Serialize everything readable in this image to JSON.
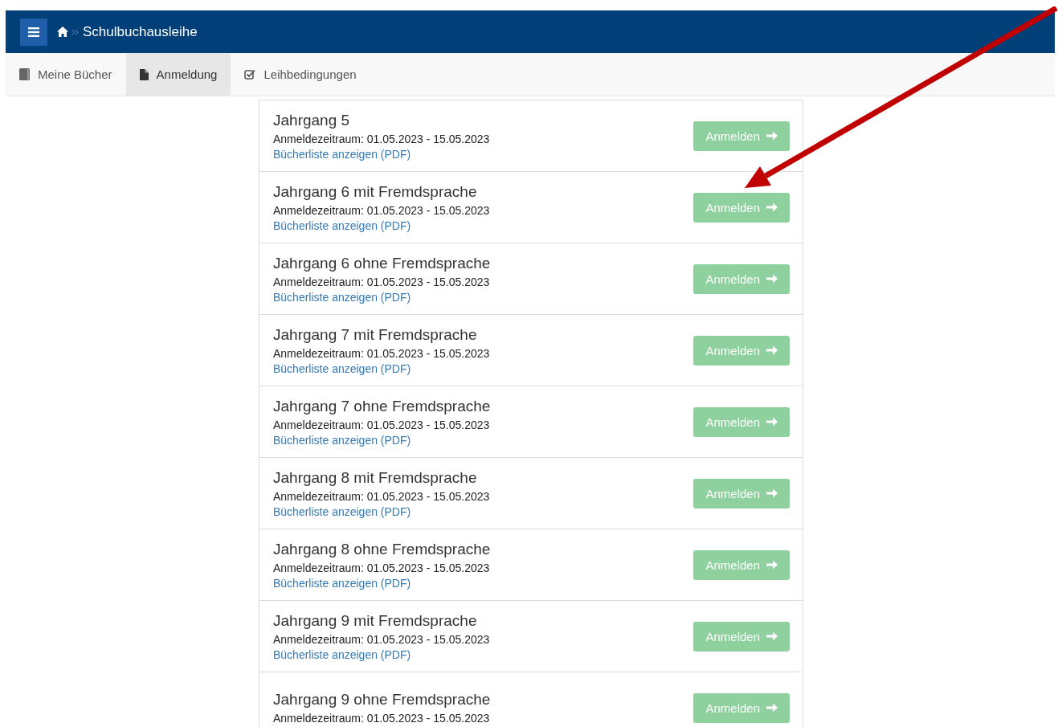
{
  "header": {
    "title": "Schulbuchausleihe"
  },
  "tabs": [
    {
      "label": "Meine Bücher",
      "selected": false
    },
    {
      "label": "Anmeldung",
      "selected": true
    },
    {
      "label": "Leihbedingungen",
      "selected": false
    }
  ],
  "registrations": [
    {
      "title": "Jahrgang 5",
      "period": "Anmeldezeitraum: 01.05.2023 - 15.05.2023",
      "link": "Bücherliste anzeigen (PDF)",
      "button": "Anmelden"
    },
    {
      "title": "Jahrgang 6 mit Fremdsprache",
      "period": "Anmeldezeitraum: 01.05.2023 - 15.05.2023",
      "link": "Bücherliste anzeigen (PDF)",
      "button": "Anmelden"
    },
    {
      "title": "Jahrgang 6 ohne Fremdsprache",
      "period": "Anmeldezeitraum: 01.05.2023 - 15.05.2023",
      "link": "Bücherliste anzeigen (PDF)",
      "button": "Anmelden"
    },
    {
      "title": "Jahrgang 7 mit Fremdsprache",
      "period": "Anmeldezeitraum: 01.05.2023 - 15.05.2023",
      "link": "Bücherliste anzeigen (PDF)",
      "button": "Anmelden"
    },
    {
      "title": "Jahrgang 7 ohne Fremdsprache",
      "period": "Anmeldezeitraum: 01.05.2023 - 15.05.2023",
      "link": "Bücherliste anzeigen (PDF)",
      "button": "Anmelden"
    },
    {
      "title": "Jahrgang 8 mit Fremdsprache",
      "period": "Anmeldezeitraum: 01.05.2023 - 15.05.2023",
      "link": "Bücherliste anzeigen (PDF)",
      "button": "Anmelden"
    },
    {
      "title": "Jahrgang 8 ohne Fremdsprache",
      "period": "Anmeldezeitraum: 01.05.2023 - 15.05.2023",
      "link": "Bücherliste anzeigen (PDF)",
      "button": "Anmelden"
    },
    {
      "title": "Jahrgang 9 mit Fremdsprache",
      "period": "Anmeldezeitraum: 01.05.2023 - 15.05.2023",
      "link": "Bücherliste anzeigen (PDF)",
      "button": "Anmelden"
    },
    {
      "title": "Jahrgang 9 ohne Fremdsprache",
      "period": "Anmeldezeitraum: 01.05.2023 - 15.05.2023",
      "button": "Anmelden"
    }
  ],
  "annotation": {
    "kind": "arrow"
  }
}
